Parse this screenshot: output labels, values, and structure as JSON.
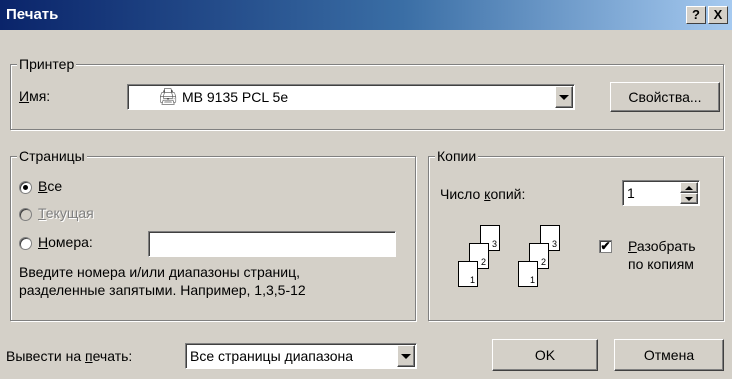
{
  "window": {
    "title": "Печать",
    "help_button": "?",
    "close_button": "X"
  },
  "printer": {
    "group_label": "Принтер",
    "name_label_u": "И",
    "name_label_rest": "мя:",
    "selected": "MB 9135 PCL 5e",
    "properties_button": "Свойства..."
  },
  "pages": {
    "group_label": "Страницы",
    "all_u": "В",
    "all_rest": "се",
    "current_u": "Т",
    "current_rest": "екущая",
    "numbers_u": "Н",
    "numbers_rest": "омера:",
    "numbers_value": "",
    "hint_line1": "Введите номера и/или диапазоны страниц,",
    "hint_line2": "разделенные запятыми. Например, 1,3,5-12"
  },
  "copies": {
    "group_label": "Копии",
    "count_label_pre": "Число ",
    "count_label_u": "к",
    "count_label_rest": "опий:",
    "count_value": "1",
    "collate_u": "Р",
    "collate_rest": "азобрать",
    "collate_line2": "по копиям",
    "collate_checked_mark": "✔",
    "page_numbers": [
      "1",
      "2",
      "3"
    ]
  },
  "print_what": {
    "label_pre": "Вывести на ",
    "label_u": "п",
    "label_rest": "ечать:",
    "selected": "Все страницы диапазона"
  },
  "buttons": {
    "ok": "OK",
    "cancel": "Отмена"
  },
  "icons": {
    "printer": "printer-icon"
  }
}
